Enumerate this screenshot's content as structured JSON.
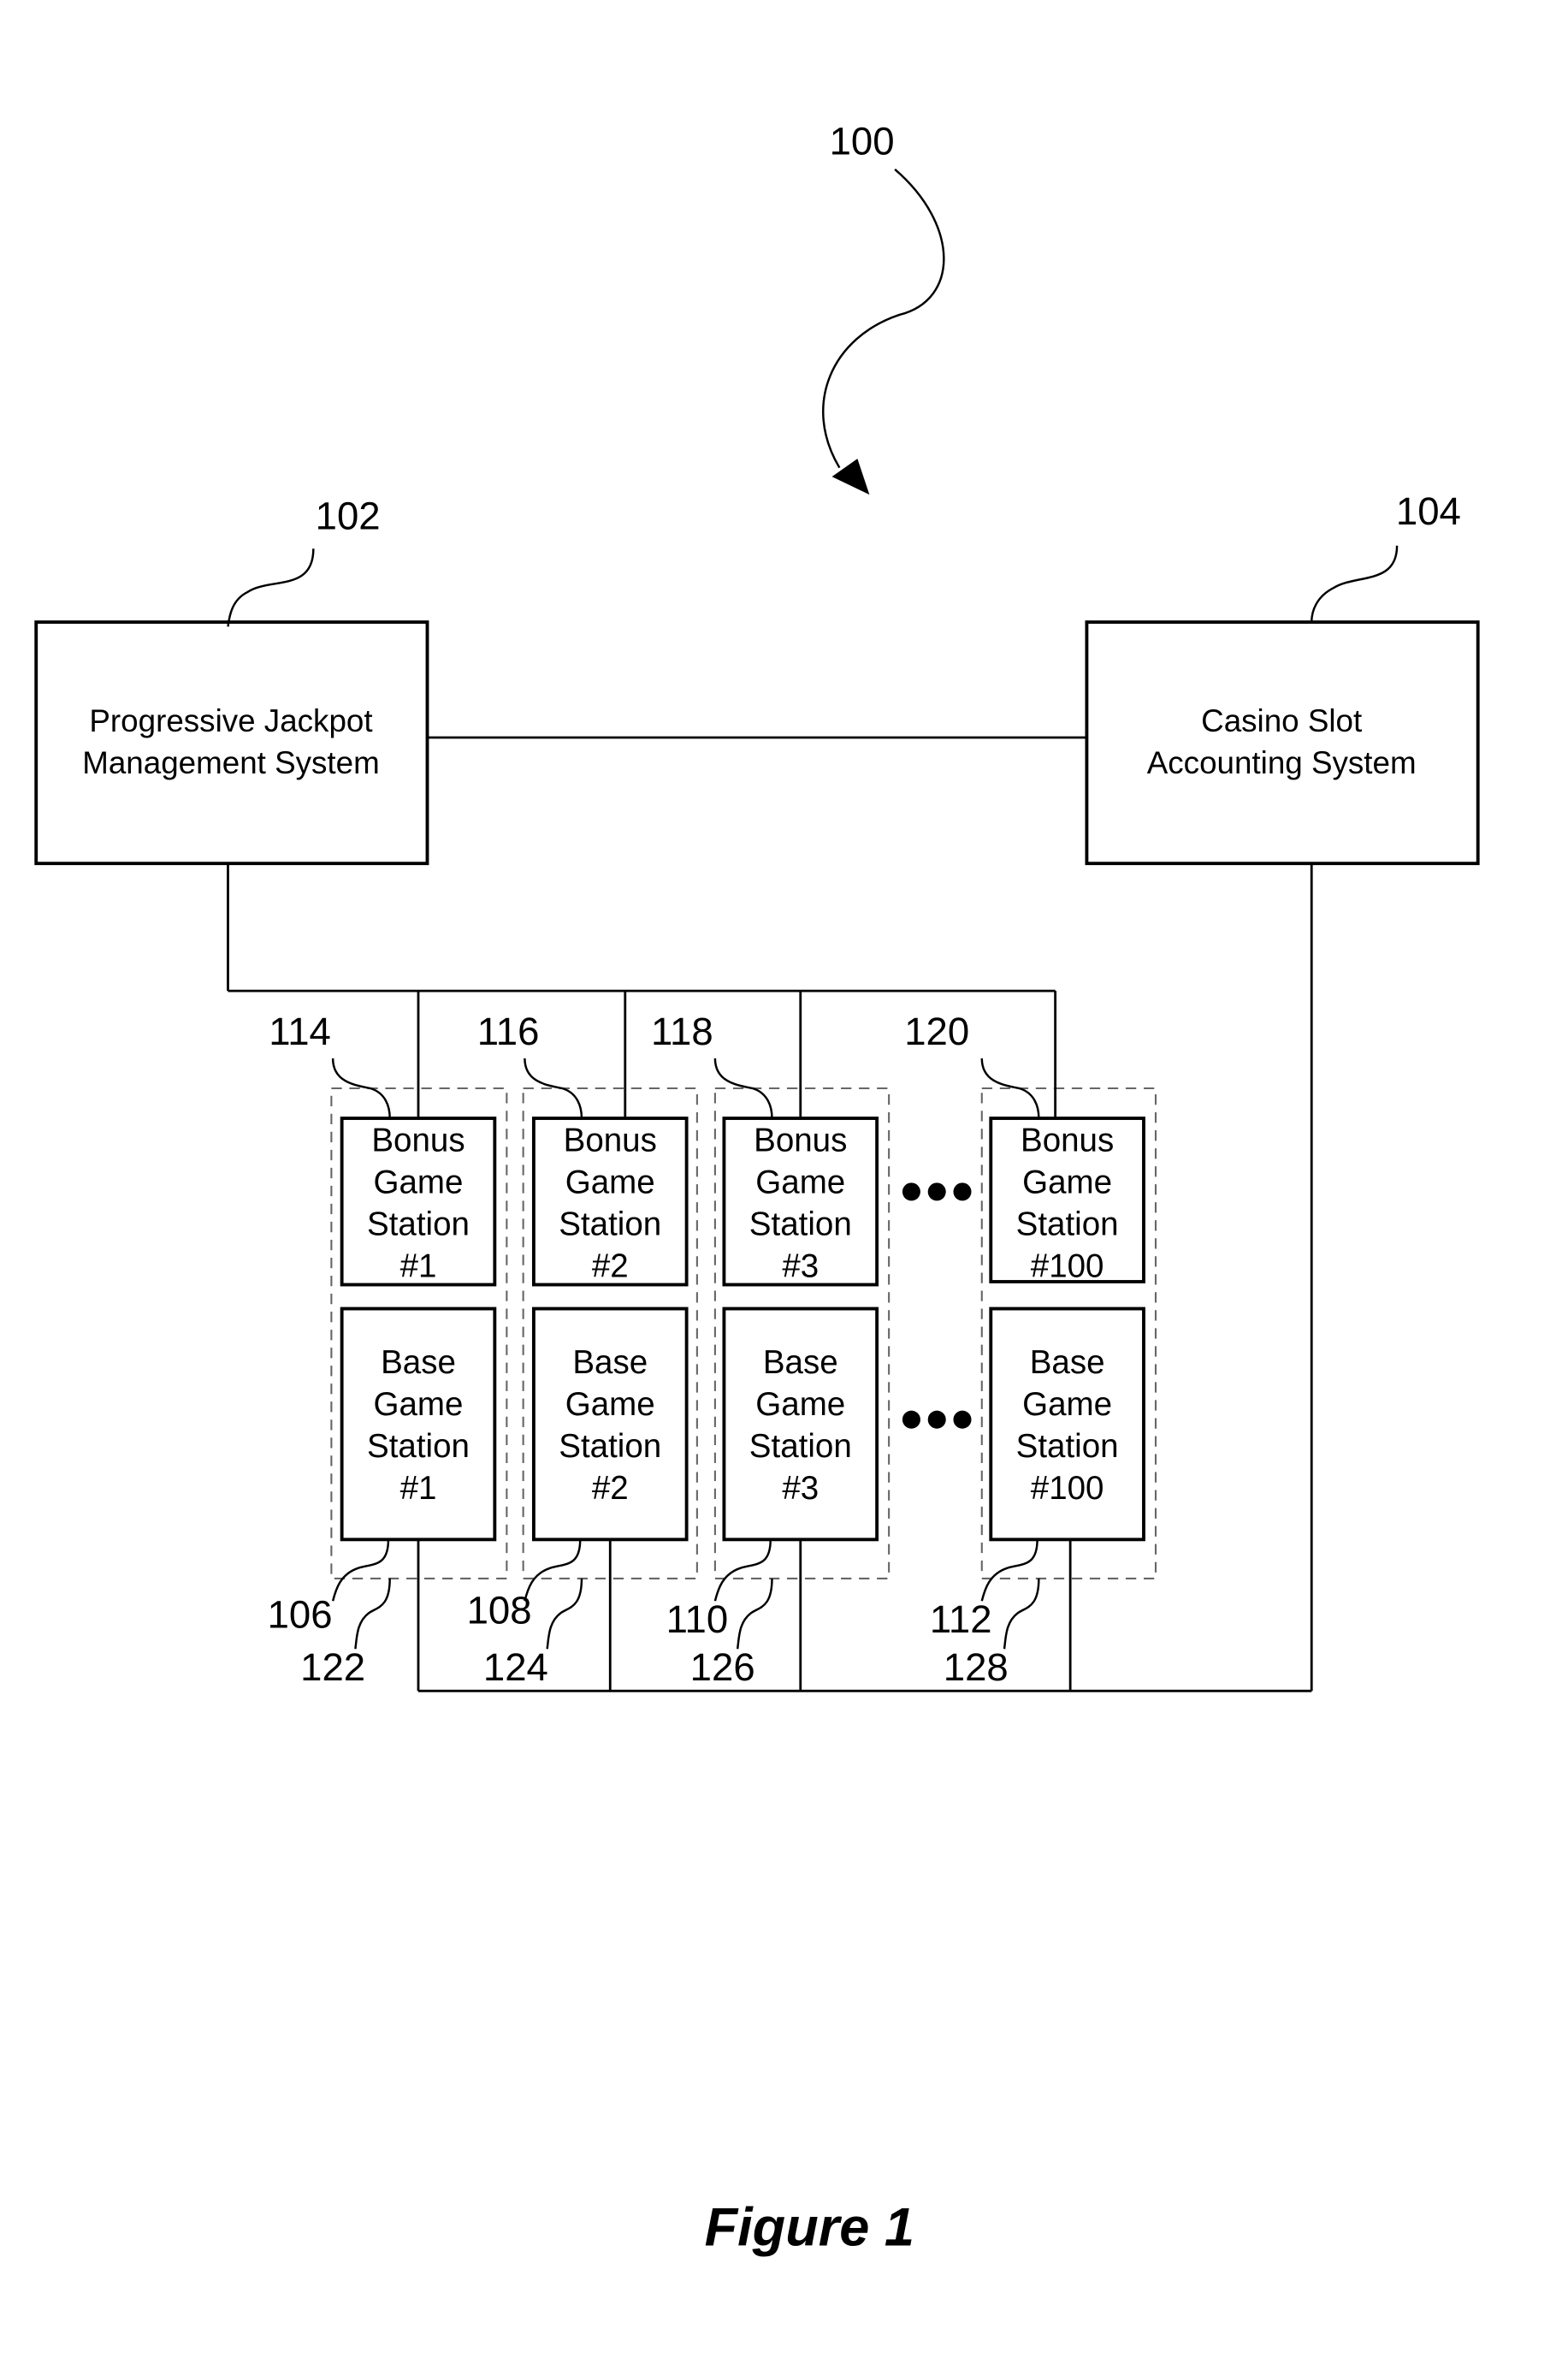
{
  "figure": {
    "caption": "Figure 1",
    "ref_system": "100"
  },
  "systems": [
    {
      "ref": "102",
      "lines": [
        "Progressive Jackpot",
        "Management System"
      ]
    },
    {
      "ref": "104",
      "lines": [
        "Casino Slot",
        "Accounting System"
      ]
    }
  ],
  "stations": [
    {
      "bonus_ref": "114",
      "base_ref": "106",
      "group_ref": "122",
      "bonus_lines": [
        "Bonus",
        "Game",
        "Station",
        "#1"
      ],
      "base_lines": [
        "Base",
        "Game",
        "Station",
        "#1"
      ]
    },
    {
      "bonus_ref": "116",
      "base_ref": "108",
      "group_ref": "124",
      "bonus_lines": [
        "Bonus",
        "Game",
        "Station",
        "#2"
      ],
      "base_lines": [
        "Base",
        "Game",
        "Station",
        "#2"
      ]
    },
    {
      "bonus_ref": "118",
      "base_ref": "110",
      "group_ref": "126",
      "bonus_lines": [
        "Bonus",
        "Game",
        "Station",
        "#3"
      ],
      "base_lines": [
        "Base",
        "Game",
        "Station",
        "#3"
      ]
    },
    {
      "bonus_ref": "120",
      "base_ref": "112",
      "group_ref": "128",
      "bonus_lines": [
        "Bonus",
        "Game",
        "Station",
        "#100"
      ],
      "base_lines": [
        "Base",
        "Game",
        "Station",
        "#100"
      ]
    }
  ],
  "ellipsis_icon": "ellipsis-dots"
}
